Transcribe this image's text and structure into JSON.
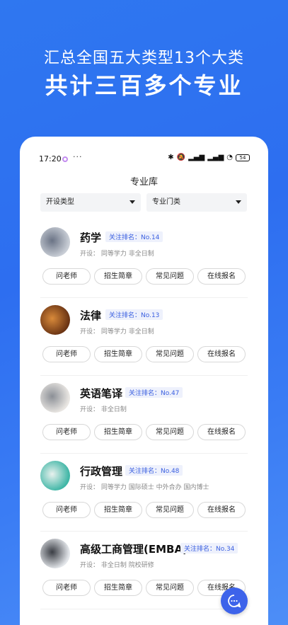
{
  "banner": {
    "line1": "汇总全国五大类型13个大类",
    "line2": "共计三百多个专业"
  },
  "status_bar": {
    "time": "17:20",
    "more": "···",
    "battery": "54"
  },
  "page_title": "专业库",
  "filters": [
    {
      "label": "开设类型"
    },
    {
      "label": "专业门类"
    }
  ],
  "majors": [
    {
      "name": "药学",
      "rank": "关注排名：No.14",
      "tags": "开设：  同等学力   非全日制",
      "thumb_colors": [
        "#c9ced6",
        "#6a7385"
      ]
    },
    {
      "name": "法律",
      "rank": "关注排名：No.13",
      "tags": "开设：  同等学力   非全日制",
      "thumb_colors": [
        "#6b3414",
        "#d98a3a"
      ]
    },
    {
      "name": "英语笔译",
      "rank": "关注排名：No.47",
      "tags": "开设：  非全日制",
      "thumb_colors": [
        "#e9e6e2",
        "#8b8f96"
      ]
    },
    {
      "name": "行政管理",
      "rank": "关注排名：No.48",
      "tags": "开设：  同等学力   国际硕士   中外合办   国内博士",
      "thumb_colors": [
        "#3fb6a6",
        "#e9f1ee"
      ]
    },
    {
      "name": "高级工商管理(EMBA)",
      "rank": "关注排名：No.34",
      "tags": "开设：  非全日制   院校研修",
      "thumb_colors": [
        "#e3e6ea",
        "#3a3d44"
      ]
    }
  ],
  "buttons": {
    "ask": "问老师",
    "guide": "招生简章",
    "faq": "常见问题",
    "apply": "在线报名"
  },
  "colors": {
    "accent": "#2f77f0",
    "rank_text": "#3a5fe0",
    "fab": "#3d63ea"
  }
}
